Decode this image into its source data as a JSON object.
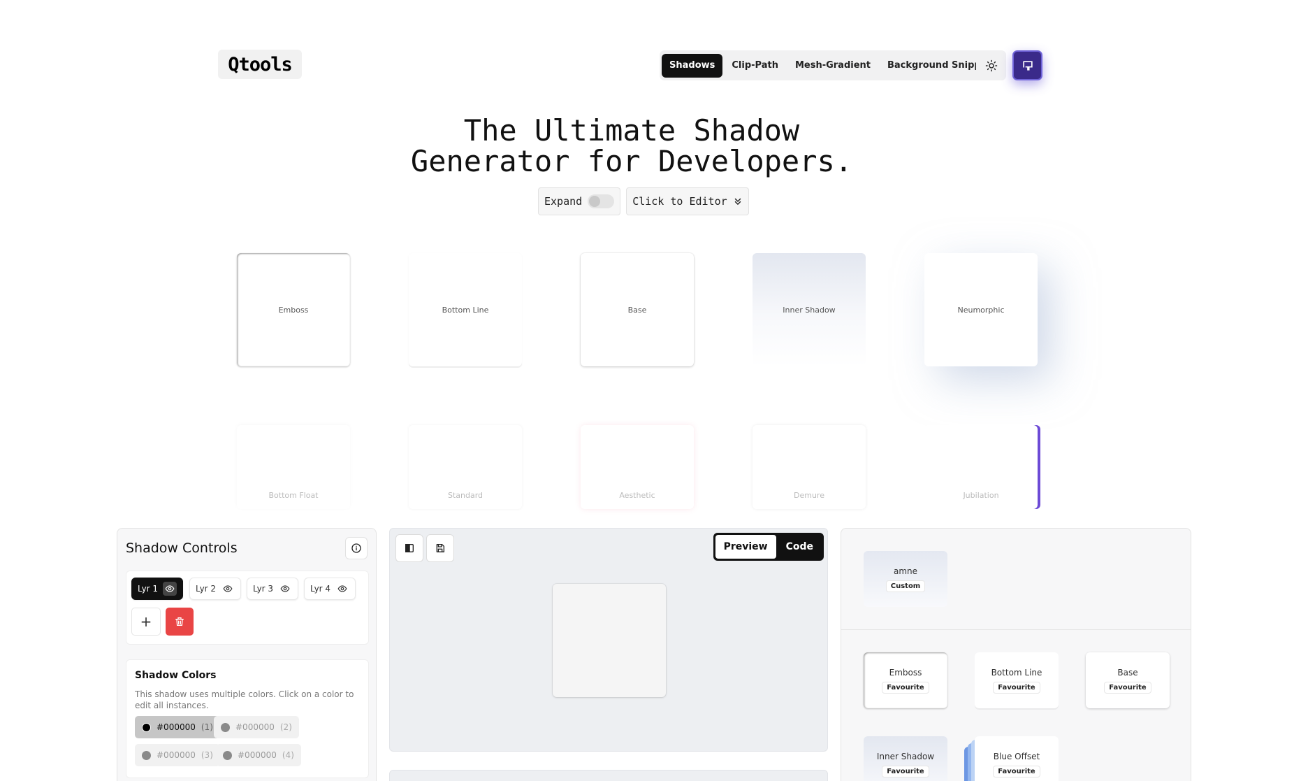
{
  "header": {
    "logo": "Qtools",
    "nav": [
      "Shadows",
      "Clip-Path",
      "Mesh-Gradient",
      "Background Snippets"
    ],
    "active_nav": "Shadows"
  },
  "hero": {
    "title_line1": "The Ultimate Shadow",
    "title_line2": "Generator for Developers.",
    "expand_label": "Expand",
    "editor_label": "Click to Editor"
  },
  "gallery": {
    "row1": [
      "Emboss",
      "Bottom Line",
      "Base",
      "Inner Shadow",
      "Neumorphic"
    ],
    "row2": [
      "Bottom Float",
      "Standard",
      "Aesthetic",
      "Demure",
      "Jubilation"
    ]
  },
  "controls": {
    "title": "Shadow Controls",
    "layers": [
      "Lyr 1",
      "Lyr 2",
      "Lyr 3",
      "Lyr 4"
    ],
    "add_label": "+",
    "colors_title": "Shadow Colors",
    "colors_desc": "This shadow uses multiple colors. Click on a color to edit all instances.",
    "colors": [
      {
        "hex": "#000000",
        "n": "(1)"
      },
      {
        "hex": "#000000",
        "n": "(2)"
      },
      {
        "hex": "#000000",
        "n": "(3)"
      },
      {
        "hex": "#000000",
        "n": "(4)"
      }
    ]
  },
  "editor": {
    "preview_label": "Preview",
    "code_label": "Code"
  },
  "saved": {
    "custom": {
      "name": "amne",
      "badge": "Custom"
    },
    "favourites": [
      {
        "name": "Emboss",
        "badge": "Favourite"
      },
      {
        "name": "Bottom Line",
        "badge": "Favourite"
      },
      {
        "name": "Base",
        "badge": "Favourite"
      },
      {
        "name": "Inner Shadow",
        "badge": "Favourite"
      },
      {
        "name": "Blue Offset",
        "badge": "Favourite"
      }
    ]
  },
  "colors": {
    "accent_purple": "#3a2a8a",
    "danger": "#e94545",
    "dark": "#111111"
  }
}
